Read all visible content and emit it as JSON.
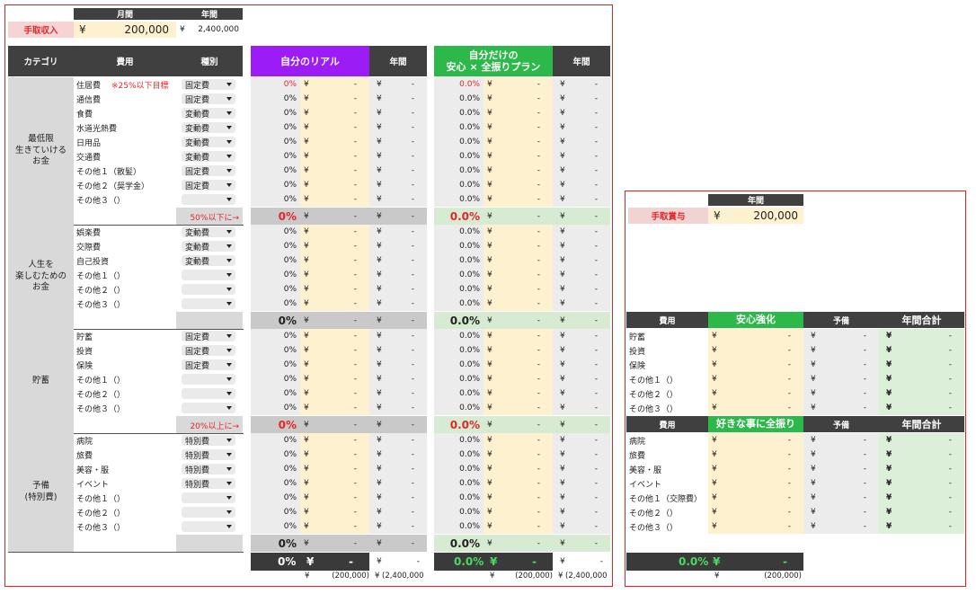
{
  "income": {
    "col_monthly": "月間",
    "col_yearly": "年間",
    "label": "手取収入",
    "yen": "¥",
    "monthly_value": "200,000",
    "yearly_value": "2,400,000"
  },
  "table_headers": {
    "category": "カテゴリ",
    "expense": "費用",
    "type": "種別",
    "real": "自分のリアル",
    "yearly": "年間",
    "plan_line1": "自分だけの",
    "plan_line2": "安心 × 全振りプラン"
  },
  "sections": [
    {
      "category_lines": [
        "最低限",
        "生きていける",
        "お金"
      ],
      "items": [
        {
          "name": "住居費",
          "note": "※25%以下目標",
          "type": "固定費",
          "real_pct": "0%",
          "plan_pct": "0.0%",
          "red": true
        },
        {
          "name": "通信費",
          "note": "",
          "type": "固定費",
          "real_pct": "0%",
          "plan_pct": "0.0%",
          "red": false
        },
        {
          "name": "食費",
          "note": "",
          "type": "変動費",
          "real_pct": "0%",
          "plan_pct": "0.0%",
          "red": false
        },
        {
          "name": "水道光熱費",
          "note": "",
          "type": "変動費",
          "real_pct": "0%",
          "plan_pct": "0.0%",
          "red": false
        },
        {
          "name": "日用品",
          "note": "",
          "type": "変動費",
          "real_pct": "0%",
          "plan_pct": "0.0%",
          "red": false
        },
        {
          "name": "交通費",
          "note": "",
          "type": "変動費",
          "real_pct": "0%",
          "plan_pct": "0.0%",
          "red": false
        },
        {
          "name": "その他１（散髪）",
          "note": "",
          "type": "固定費",
          "real_pct": "0%",
          "plan_pct": "0.0%",
          "red": false
        },
        {
          "name": "その他２（奨学金）",
          "note": "",
          "type": "固定費",
          "real_pct": "0%",
          "plan_pct": "0.0%",
          "red": false
        },
        {
          "name": "その他３（）",
          "note": "",
          "type": "",
          "real_pct": "0%",
          "plan_pct": "0.0%",
          "red": false
        }
      ],
      "subtotal_note": "50%以下に→",
      "subtotal_real": "0%",
      "subtotal_plan": "0.0%",
      "subtotal_red": true
    },
    {
      "category_lines": [
        "人生を",
        "楽しむための",
        "お金"
      ],
      "items": [
        {
          "name": "娯楽費",
          "note": "",
          "type": "変動費",
          "real_pct": "0%",
          "plan_pct": "0.0%",
          "red": false
        },
        {
          "name": "交際費",
          "note": "",
          "type": "変動費",
          "real_pct": "0%",
          "plan_pct": "0.0%",
          "red": false
        },
        {
          "name": "自己投資",
          "note": "",
          "type": "変動費",
          "real_pct": "0%",
          "plan_pct": "0.0%",
          "red": false
        },
        {
          "name": "その他１（）",
          "note": "",
          "type": "",
          "real_pct": "0%",
          "plan_pct": "0.0%",
          "red": false
        },
        {
          "name": "その他２（）",
          "note": "",
          "type": "",
          "real_pct": "0%",
          "plan_pct": "0.0%",
          "red": false
        },
        {
          "name": "その他３（）",
          "note": "",
          "type": "",
          "real_pct": "0%",
          "plan_pct": "0.0%",
          "red": false
        }
      ],
      "subtotal_note": "",
      "subtotal_real": "0%",
      "subtotal_plan": "0.0%",
      "subtotal_red": false
    },
    {
      "category_lines": [
        "貯蓄"
      ],
      "items": [
        {
          "name": "貯蓄",
          "note": "",
          "type": "固定費",
          "real_pct": "0%",
          "plan_pct": "0.0%",
          "red": false
        },
        {
          "name": "投資",
          "note": "",
          "type": "固定費",
          "real_pct": "0%",
          "plan_pct": "0.0%",
          "red": false
        },
        {
          "name": "保険",
          "note": "",
          "type": "固定費",
          "real_pct": "0%",
          "plan_pct": "0.0%",
          "red": false
        },
        {
          "name": "その他１（）",
          "note": "",
          "type": "",
          "real_pct": "0%",
          "plan_pct": "0.0%",
          "red": false
        },
        {
          "name": "その他２（）",
          "note": "",
          "type": "",
          "real_pct": "0%",
          "plan_pct": "0.0%",
          "red": false
        },
        {
          "name": "その他３（）",
          "note": "",
          "type": "",
          "real_pct": "0%",
          "plan_pct": "0.0%",
          "red": false
        }
      ],
      "subtotal_note": "20%以上に→",
      "subtotal_real": "0%",
      "subtotal_plan": "0.0%",
      "subtotal_red": true
    },
    {
      "category_lines": [
        "予備",
        "(特別費)"
      ],
      "items": [
        {
          "name": "病院",
          "note": "",
          "type": "特別費",
          "real_pct": "0%",
          "plan_pct": "0.0%",
          "red": false
        },
        {
          "name": "旅費",
          "note": "",
          "type": "特別費",
          "real_pct": "0%",
          "plan_pct": "0.0%",
          "red": false
        },
        {
          "name": "美容・服",
          "note": "",
          "type": "特別費",
          "real_pct": "0%",
          "plan_pct": "0.0%",
          "red": false
        },
        {
          "name": "イベント",
          "note": "",
          "type": "特別費",
          "real_pct": "0%",
          "plan_pct": "0.0%",
          "red": false
        },
        {
          "name": "その他１（）",
          "note": "",
          "type": "",
          "real_pct": "0%",
          "plan_pct": "0.0%",
          "red": false
        },
        {
          "name": "その他２（）",
          "note": "",
          "type": "",
          "real_pct": "0%",
          "plan_pct": "0.0%",
          "red": false
        },
        {
          "name": "その他３（）",
          "note": "",
          "type": "",
          "real_pct": "0%",
          "plan_pct": "0.0%",
          "red": false
        }
      ],
      "subtotal_note": "",
      "subtotal_real": "0%",
      "subtotal_plan": "0.0%",
      "subtotal_red": false
    }
  ],
  "cells": {
    "yen": "¥",
    "dash": "-"
  },
  "grand_total": {
    "real_pct": "0%",
    "plan_pct": "0.0%",
    "yen": "¥",
    "dash": "-",
    "balance_monthly": "(200,000)",
    "balance_yearly": "(2,400,000"
  },
  "bonus": {
    "col_yearly": "年間",
    "label": "手取賞与",
    "yen": "¥",
    "value": "200,000",
    "tables": [
      {
        "header_expense": "費用",
        "header_plan": "安心強化",
        "header_reserve": "予備",
        "header_total": "年間合計",
        "items": [
          "貯蓄",
          "投資",
          "保険",
          "その他１（）",
          "その他２（）",
          "その他３（）"
        ]
      },
      {
        "header_expense": "費用",
        "header_plan": "好きな事に全振り",
        "header_reserve": "予備",
        "header_total": "年間合計",
        "items": [
          "病院",
          "旅費",
          "美容・服",
          "イベント",
          "その他１（交際費）",
          "その他２（）",
          "その他３（）"
        ]
      }
    ],
    "total_pct": "0.0%",
    "total_yen": "¥",
    "total_dash": "-",
    "balance": "(200,000)"
  }
}
